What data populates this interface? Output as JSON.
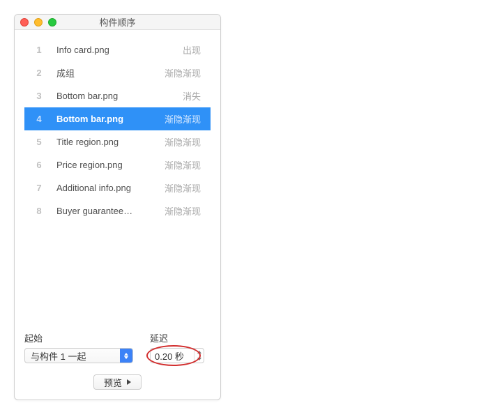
{
  "window": {
    "title": "构件顺序"
  },
  "list": {
    "items": [
      {
        "index": "1",
        "name": "Info card.png",
        "effect": "出现"
      },
      {
        "index": "2",
        "name": "成组",
        "effect": "渐隐渐现"
      },
      {
        "index": "3",
        "name": "Bottom bar.png",
        "effect": "消失"
      },
      {
        "index": "4",
        "name": "Bottom bar.png",
        "effect": "渐隐渐现"
      },
      {
        "index": "5",
        "name": "Title region.png",
        "effect": "渐隐渐现"
      },
      {
        "index": "6",
        "name": "Price region.png",
        "effect": "渐隐渐现"
      },
      {
        "index": "7",
        "name": "Additional info.png",
        "effect": "渐隐渐现"
      },
      {
        "index": "8",
        "name": "Buyer guarantee…",
        "effect": "渐隐渐现"
      }
    ],
    "selected_index": 3
  },
  "controls": {
    "start_label": "起始",
    "start_value": "与构件 1 一起",
    "delay_label": "延迟",
    "delay_value": "0.20 秒"
  },
  "preview": {
    "label": "预览"
  }
}
